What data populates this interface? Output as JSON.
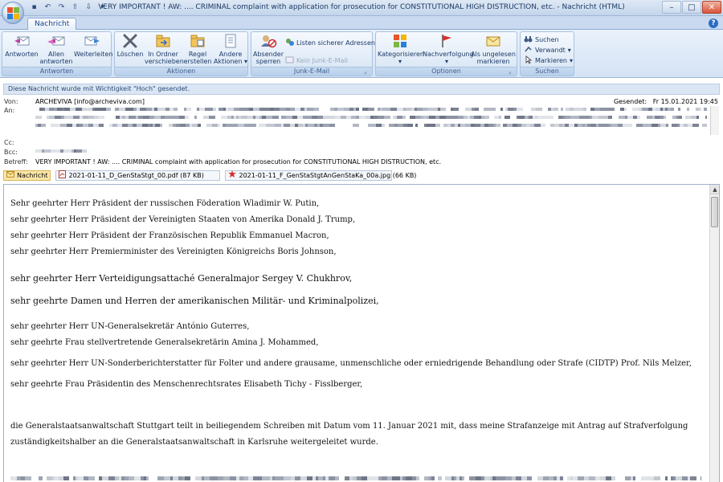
{
  "window": {
    "title": "VERY IMPORTANT ! AW: ....  CRIMINAL complaint with application for prosecution for CONSTITUTIONAL HIGH DISTRUCTION, etc. - Nachricht (HTML)",
    "tab": "Nachricht"
  },
  "ribbon": {
    "groups": {
      "antworten": "Antworten",
      "aktionen": "Aktionen",
      "junk": "Junk-E-Mail",
      "optionen": "Optionen",
      "suchen": "Suchen"
    },
    "antworten": "Antworten",
    "allen_antworten": [
      "Allen",
      "antworten"
    ],
    "weiterleiten": "Weiterleiten",
    "loeschen": "Löschen",
    "in_ordner": [
      "In Ordner",
      "verschieben"
    ],
    "regel": [
      "Regel",
      "erstellen"
    ],
    "andere": [
      "Andere",
      "Aktionen"
    ],
    "absender": [
      "Absender",
      "sperren"
    ],
    "listen": "Listen sicherer Adressen",
    "kein_junk": "Kein Junk-E-Mail",
    "kategorisieren": "Kategorisieren",
    "nachverfolgung": "Nachverfolgung",
    "ungelesen": [
      "Als ungelesen",
      "markieren"
    ],
    "suchen": "Suchen",
    "verwandt": "Verwandt",
    "markieren": "Markieren"
  },
  "infobar": "Diese Nachricht wurde mit Wichtigkeit \"Hoch\" gesendet.",
  "header": {
    "von_label": "Von:",
    "von": "ARCHEVIVA [info@archeviva.com]",
    "gesendet_label": "Gesendet:",
    "gesendet": "Fr 15.01.2021 19:45",
    "an_label": "An:",
    "cc_label": "Cc:",
    "bcc_label": "Bcc:",
    "betreff_label": "Betreff:",
    "betreff": "VERY IMPORTANT ! AW: ....  CRIMINAL complaint with application for prosecution for CONSTITUTIONAL HIGH DISTRUCTION, etc."
  },
  "attachments": [
    "Nachricht",
    "2021-01-11_D_GenStaStgt_00.pdf (87 KB)",
    "2021-01-11_F_GenStaStgtAnGenStaKa_00a.jpg (66 KB)"
  ],
  "body": [
    "Sehr geehrter Herr Präsident der russischen Föderation Wladimir W. Putin,",
    "sehr geehrter Herr Präsident der Vereinigten Staaten von Amerika Donald J. Trump,",
    "sehr geehrter Herr Präsident der Französischen Republik Emmanuel Macron,",
    "sehr geehrter Herr Premierminister des Vereinigten Königreichs Boris Johnson,",
    "sehr geehrter Herr Verteidigungsattaché Generalmajor Sergey V. Chukhrov,",
    "sehr geehrte Damen und Herren der amerikanischen Militär- und Kriminalpolizei,",
    "sehr geehrter Herr UN-Generalsekretär António Guterres,",
    "sehr geehrte Frau stellvertretende Generalsekretärin Amina J. Mohammed,",
    "sehr geehrter Herr UN-Sonderberichterstatter für Folter und andere grausame, unmenschliche oder erniedrigende Behandlung oder Strafe (CIDTP) Prof. Nils Melzer,",
    "sehr geehrte Frau Präsidentin des Menschenrechtsrates Elisabeth Tichy - Fisslberger,",
    "die Generalstaatsanwaltschaft Stuttgart teilt in beiliegendem Schreiben mit Datum vom 11. Januar 2021 mit, dass meine Strafanzeige mit Antrag auf Strafverfolgung",
    "zuständigkeitshalber an die Generalstaatsanwaltschaft in Karlsruhe weitergeleitet wurde."
  ]
}
